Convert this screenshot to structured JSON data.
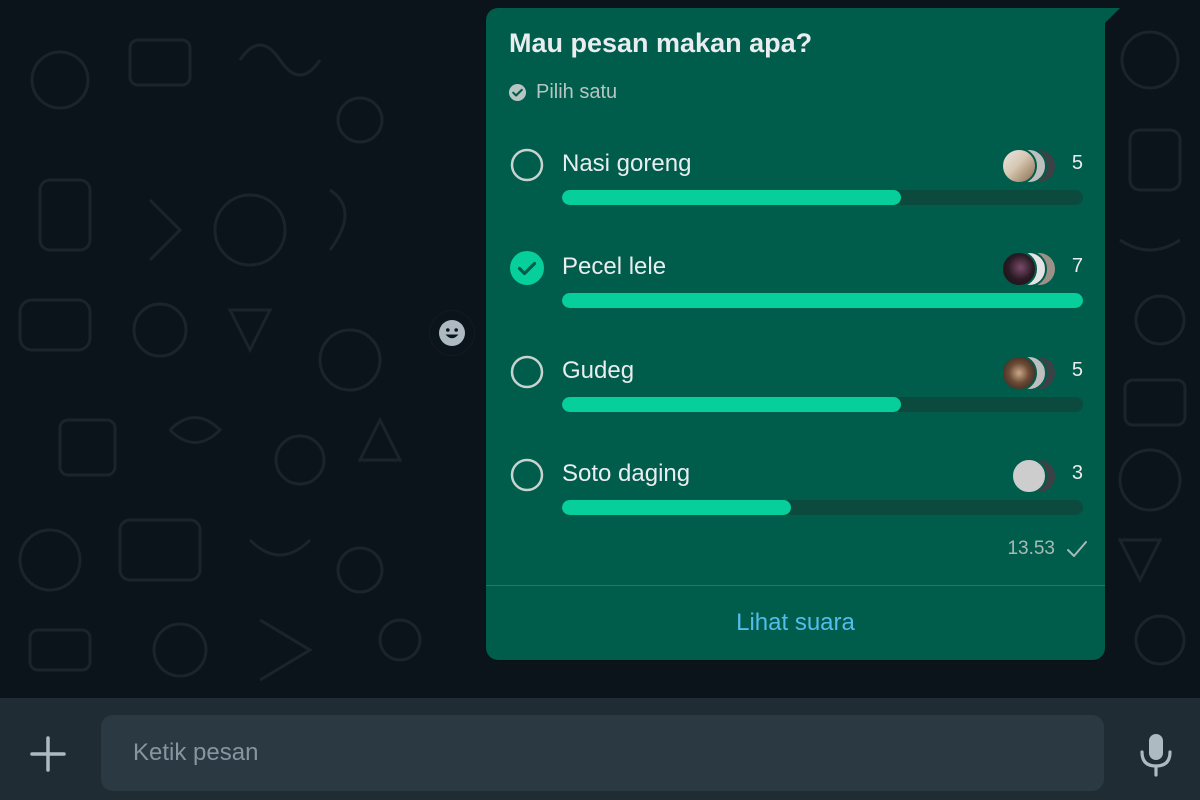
{
  "poll": {
    "question": "Mau pesan makan apa?",
    "selection_hint": "Pilih satu",
    "options": [
      {
        "label": "Nasi goreng",
        "votes": "5",
        "fill": 0.65,
        "selected": false
      },
      {
        "label": "Pecel lele",
        "votes": "7",
        "fill": 1.0,
        "selected": true
      },
      {
        "label": "Gudeg",
        "votes": "5",
        "fill": 0.65,
        "selected": false
      },
      {
        "label": "Soto daging",
        "votes": "3",
        "fill": 0.44,
        "selected": false
      }
    ],
    "time": "13.53",
    "view_votes_label": "Lihat suara"
  },
  "composer": {
    "placeholder": "Ketik pesan"
  },
  "icons": {
    "check_circle": "check-circle-icon",
    "radio": "radio-icon",
    "sent_tick": "single-check-icon",
    "emoji": "emoji-icon",
    "plus": "plus-icon",
    "mic": "mic-icon"
  },
  "colors": {
    "bubble": "#005c4b",
    "bar_fill": "#06cf9c",
    "bar_track": "#0c4a3d",
    "link": "#53bdeb",
    "background": "#0b141a",
    "composer": "#1f2c34"
  }
}
